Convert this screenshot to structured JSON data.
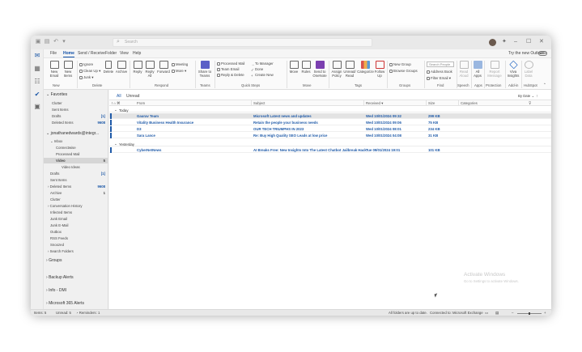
{
  "titlebar": {
    "search_placeholder": "Search"
  },
  "menu": {
    "tabs": [
      "File",
      "Home",
      "Send / Receive",
      "Folder",
      "View",
      "Help"
    ],
    "active_tab": "Home",
    "try_new_label": "Try the new Outlook",
    "toggle_label": "Off"
  },
  "ribbon": {
    "new_email": "New\nEmail",
    "new_items": "New\nItems",
    "ignore": "Ignore",
    "clean_up": "Clean Up",
    "junk": "Junk",
    "delete": "Delete",
    "archive": "Archive",
    "reply": "Reply",
    "reply_all": "Reply\nAll",
    "forward": "Forward",
    "meeting": "Meeting",
    "im": "IM",
    "more": "More",
    "share_to_teams": "Share to\nTeams",
    "qs_processed": "Processed Mail",
    "qs_team_email": "Team Email",
    "qs_reply_delete": "Reply & Delete",
    "qs_to_manager": "To Manager",
    "qs_done": "Done",
    "qs_create_new": "Create New",
    "move": "Move",
    "rules": "Rules",
    "send_to_onenote": "Send to\nOneNote",
    "assign_policy": "Assign\nPolicy",
    "unread_read": "Unread/\nRead",
    "categorize": "Categorize",
    "follow_up": "Follow\nUp",
    "new_group": "New Group",
    "browse_groups": "Browse Groups",
    "search_people": "Search People",
    "address_book": "Address Book",
    "filter_email": "Filter Email",
    "read_aloud": "Read\nAloud",
    "all_apps": "All\nApps",
    "report_message": "Report\nMessage",
    "viva_insights": "Viva\nInsights",
    "label_data": "Label\nData",
    "groups": [
      "New",
      "Delete",
      "Respond",
      "Teams",
      "Quick Steps",
      "Move",
      "Tags",
      "Groups",
      "Find",
      "Speech",
      "Apps",
      "Protection",
      "Add-in",
      "HubSpot"
    ]
  },
  "folders": {
    "favorites_header": "Favorites",
    "favorites": [
      {
        "label": "Clutter",
        "count": ""
      },
      {
        "label": "Sent Items",
        "count": ""
      },
      {
        "label": "Drafts",
        "count": "[1]"
      },
      {
        "label": "Deleted Items",
        "count": "9608"
      }
    ],
    "account_header": "jonathanedwards@integr...",
    "items": [
      {
        "label": "Inbox",
        "count": ""
      },
      {
        "label": "Connectwise",
        "count": ""
      },
      {
        "label": "Processed Mail",
        "count": ""
      },
      {
        "label": "Video",
        "count": "5"
      },
      {
        "label": "Video Ideas",
        "count": ""
      },
      {
        "label": "Drafts",
        "count": "[1]"
      },
      {
        "label": "Sent Items",
        "count": ""
      },
      {
        "label": "Deleted Items",
        "count": "9608"
      },
      {
        "label": "Archive",
        "count": "1"
      },
      {
        "label": "Clutter",
        "count": ""
      },
      {
        "label": "Conversation History",
        "count": ""
      },
      {
        "label": "Infected Items",
        "count": ""
      },
      {
        "label": "Junk Email",
        "count": ""
      },
      {
        "label": "Junk E-Mail",
        "count": ""
      },
      {
        "label": "Outbox",
        "count": ""
      },
      {
        "label": "RSS Feeds",
        "count": ""
      },
      {
        "label": "Snoozed",
        "count": ""
      },
      {
        "label": "Search Folders",
        "count": ""
      }
    ],
    "groups_header": "Groups",
    "shared": [
      "Backup Alerts",
      "Info - DMI",
      "Microsoft 365 Alerts"
    ]
  },
  "list": {
    "tab_all": "All",
    "tab_unread": "Unread",
    "sort_label": "By Date",
    "columns": [
      "From",
      "Subject",
      "Received",
      "Size",
      "Categories"
    ],
    "group_today": "Today",
    "group_yesterday": "Yesterday",
    "today": [
      {
        "from": "Gaurav Team",
        "subject": "Microsoft Latest news and updates",
        "received": "Wed 10/01/2024 09:32",
        "size": "299 KB"
      },
      {
        "from": "Vitality Business Health Insurance",
        "subject": "Retain the people your business needs",
        "received": "Wed 10/01/2024 09:06",
        "size": "75 KB"
      },
      {
        "from": "D3",
        "subject": "OUR TECH TRIUMPHS IN 2023",
        "received": "Wed 10/01/2024 08:01",
        "size": "234 KB"
      },
      {
        "from": "Sara Lance",
        "subject": "Re: Buy High Quality SEO Leads at low price",
        "received": "Wed 10/01/2024 04:08",
        "size": "31 KB"
      }
    ],
    "yesterday": [
      {
        "from": "CyberNetNews",
        "subject": "AI Breaks Free: New Insights Into The Latest Chatbot Jailbreak Hack",
        "received": "Tue 09/01/2024 19:01",
        "size": "101 KB"
      }
    ]
  },
  "watermark": {
    "line1": "Activate Windows",
    "line2": "Go to Settings to activate Windows."
  },
  "status": {
    "items": "Items: 5",
    "unread": "Unread: 5",
    "reminders": "Reminders: 1",
    "uptodate": "All folders are up to date.",
    "connected": "Connected to: Microsoft Exchange"
  },
  "colors": {
    "accent": "#1f5aa8",
    "ribbon_blue": "#2b6cc4",
    "onenote_purple": "#7b3fb0"
  }
}
